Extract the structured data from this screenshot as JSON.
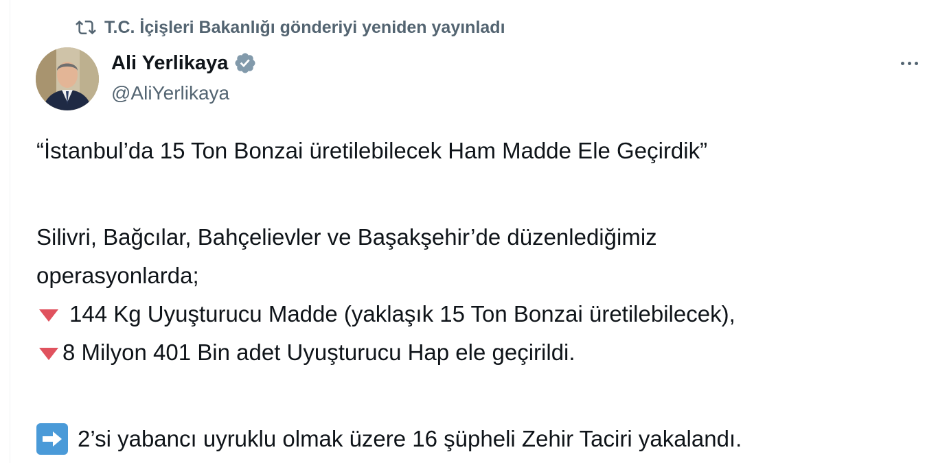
{
  "repost": {
    "text": "T.C. İçişleri Bakanlığı gönderiyi yeniden yayınladı",
    "icon": "repost-icon"
  },
  "author": {
    "name": "Ali Yerlikaya",
    "handle": "@AliYerlikaya",
    "verified_icon": "verified-badge-icon",
    "verified_color": "#829aab"
  },
  "more_icon": "more-options-icon",
  "tweet": {
    "headline": "“İstanbul’da 15 Ton Bonzai üretilebilecek Ham Madde Ele Geçirdik”",
    "intro_line1": "Silivri, Bağcılar, Bahçelievler ve Başakşehir’de düzenlediğimiz",
    "intro_line2": "operasyonlarda;",
    "item1": "144 Kg Uyuşturucu Madde (yaklaşık 15 Ton Bonzai üretilebilecek),",
    "item2": "8 Milyon 401 Bin adet Uyuşturucu Hap ele geçirildi.",
    "conclusion": "2’si yabancı uyruklu olmak üzere 16 şüpheli Zehir Taciri yakalandı.",
    "bullet_icon": "red-triangle-down-icon",
    "bullet_color": "#e0525e",
    "arrow_icon": "right-arrow-emoji-icon",
    "arrow_color": "#4a9ad8"
  }
}
